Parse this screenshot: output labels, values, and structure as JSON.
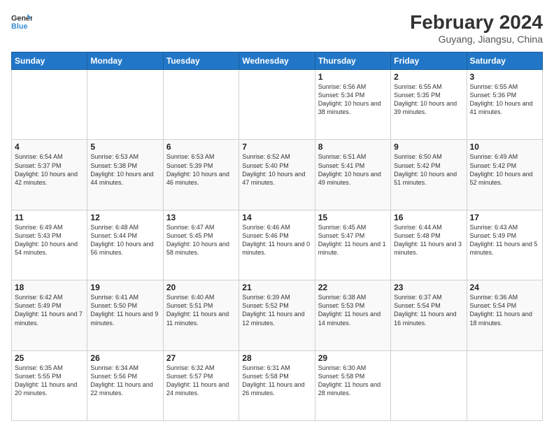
{
  "header": {
    "logo_line1": "General",
    "logo_line2": "Blue",
    "month_year": "February 2024",
    "location": "Guyang, Jiangsu, China"
  },
  "weekdays": [
    "Sunday",
    "Monday",
    "Tuesday",
    "Wednesday",
    "Thursday",
    "Friday",
    "Saturday"
  ],
  "weeks": [
    [
      {
        "num": "",
        "info": ""
      },
      {
        "num": "",
        "info": ""
      },
      {
        "num": "",
        "info": ""
      },
      {
        "num": "",
        "info": ""
      },
      {
        "num": "1",
        "info": "Sunrise: 6:56 AM\nSunset: 5:34 PM\nDaylight: 10 hours and 38 minutes."
      },
      {
        "num": "2",
        "info": "Sunrise: 6:55 AM\nSunset: 5:35 PM\nDaylight: 10 hours and 39 minutes."
      },
      {
        "num": "3",
        "info": "Sunrise: 6:55 AM\nSunset: 5:36 PM\nDaylight: 10 hours and 41 minutes."
      }
    ],
    [
      {
        "num": "4",
        "info": "Sunrise: 6:54 AM\nSunset: 5:37 PM\nDaylight: 10 hours and 42 minutes."
      },
      {
        "num": "5",
        "info": "Sunrise: 6:53 AM\nSunset: 5:38 PM\nDaylight: 10 hours and 44 minutes."
      },
      {
        "num": "6",
        "info": "Sunrise: 6:53 AM\nSunset: 5:39 PM\nDaylight: 10 hours and 46 minutes."
      },
      {
        "num": "7",
        "info": "Sunrise: 6:52 AM\nSunset: 5:40 PM\nDaylight: 10 hours and 47 minutes."
      },
      {
        "num": "8",
        "info": "Sunrise: 6:51 AM\nSunset: 5:41 PM\nDaylight: 10 hours and 49 minutes."
      },
      {
        "num": "9",
        "info": "Sunrise: 6:50 AM\nSunset: 5:42 PM\nDaylight: 10 hours and 51 minutes."
      },
      {
        "num": "10",
        "info": "Sunrise: 6:49 AM\nSunset: 5:42 PM\nDaylight: 10 hours and 52 minutes."
      }
    ],
    [
      {
        "num": "11",
        "info": "Sunrise: 6:49 AM\nSunset: 5:43 PM\nDaylight: 10 hours and 54 minutes."
      },
      {
        "num": "12",
        "info": "Sunrise: 6:48 AM\nSunset: 5:44 PM\nDaylight: 10 hours and 56 minutes."
      },
      {
        "num": "13",
        "info": "Sunrise: 6:47 AM\nSunset: 5:45 PM\nDaylight: 10 hours and 58 minutes."
      },
      {
        "num": "14",
        "info": "Sunrise: 6:46 AM\nSunset: 5:46 PM\nDaylight: 11 hours and 0 minutes."
      },
      {
        "num": "15",
        "info": "Sunrise: 6:45 AM\nSunset: 5:47 PM\nDaylight: 11 hours and 1 minute."
      },
      {
        "num": "16",
        "info": "Sunrise: 6:44 AM\nSunset: 5:48 PM\nDaylight: 11 hours and 3 minutes."
      },
      {
        "num": "17",
        "info": "Sunrise: 6:43 AM\nSunset: 5:49 PM\nDaylight: 11 hours and 5 minutes."
      }
    ],
    [
      {
        "num": "18",
        "info": "Sunrise: 6:42 AM\nSunset: 5:49 PM\nDaylight: 11 hours and 7 minutes."
      },
      {
        "num": "19",
        "info": "Sunrise: 6:41 AM\nSunset: 5:50 PM\nDaylight: 11 hours and 9 minutes."
      },
      {
        "num": "20",
        "info": "Sunrise: 6:40 AM\nSunset: 5:51 PM\nDaylight: 11 hours and 11 minutes."
      },
      {
        "num": "21",
        "info": "Sunrise: 6:39 AM\nSunset: 5:52 PM\nDaylight: 11 hours and 12 minutes."
      },
      {
        "num": "22",
        "info": "Sunrise: 6:38 AM\nSunset: 5:53 PM\nDaylight: 11 hours and 14 minutes."
      },
      {
        "num": "23",
        "info": "Sunrise: 6:37 AM\nSunset: 5:54 PM\nDaylight: 11 hours and 16 minutes."
      },
      {
        "num": "24",
        "info": "Sunrise: 6:36 AM\nSunset: 5:54 PM\nDaylight: 11 hours and 18 minutes."
      }
    ],
    [
      {
        "num": "25",
        "info": "Sunrise: 6:35 AM\nSunset: 5:55 PM\nDaylight: 11 hours and 20 minutes."
      },
      {
        "num": "26",
        "info": "Sunrise: 6:34 AM\nSunset: 5:56 PM\nDaylight: 11 hours and 22 minutes."
      },
      {
        "num": "27",
        "info": "Sunrise: 6:32 AM\nSunset: 5:57 PM\nDaylight: 11 hours and 24 minutes."
      },
      {
        "num": "28",
        "info": "Sunrise: 6:31 AM\nSunset: 5:58 PM\nDaylight: 11 hours and 26 minutes."
      },
      {
        "num": "29",
        "info": "Sunrise: 6:30 AM\nSunset: 5:58 PM\nDaylight: 11 hours and 28 minutes."
      },
      {
        "num": "",
        "info": ""
      },
      {
        "num": "",
        "info": ""
      }
    ]
  ]
}
